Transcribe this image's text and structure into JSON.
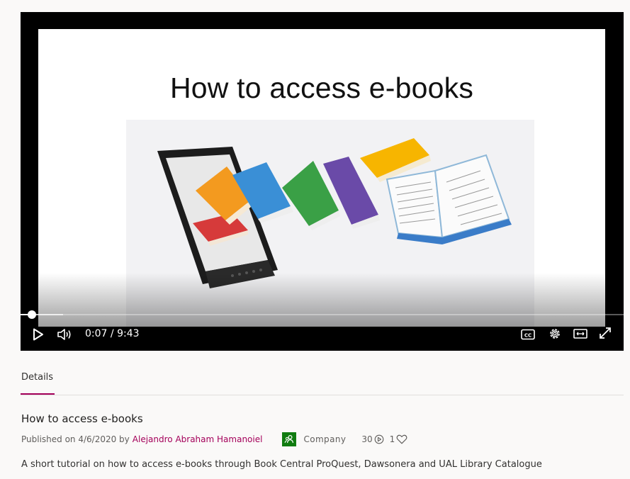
{
  "player": {
    "slide_title": "How to access e-books",
    "current_time": "0:07",
    "separator": "/",
    "duration": "9:43",
    "progress_fraction": 0.012,
    "icons": [
      "play-icon",
      "volume-icon",
      "closed-captions-icon",
      "settings-gear-icon",
      "theater-mode-icon",
      "fullscreen-icon"
    ]
  },
  "tabs": {
    "details_label": "Details"
  },
  "video": {
    "title": "How to access e-books",
    "published_prefix": "Published on 4/6/2020 by",
    "author": "Alejandro Abraham Hamanoiel",
    "group": "Company",
    "views": "30",
    "likes": "1",
    "description": "A short tutorial on how to access e-books through Book Central ProQuest, Dawsonera and UAL Library Catalogue"
  },
  "colors": {
    "accent": "#a4005a",
    "group_badge": "#107c10",
    "player_bg": "#000000"
  }
}
